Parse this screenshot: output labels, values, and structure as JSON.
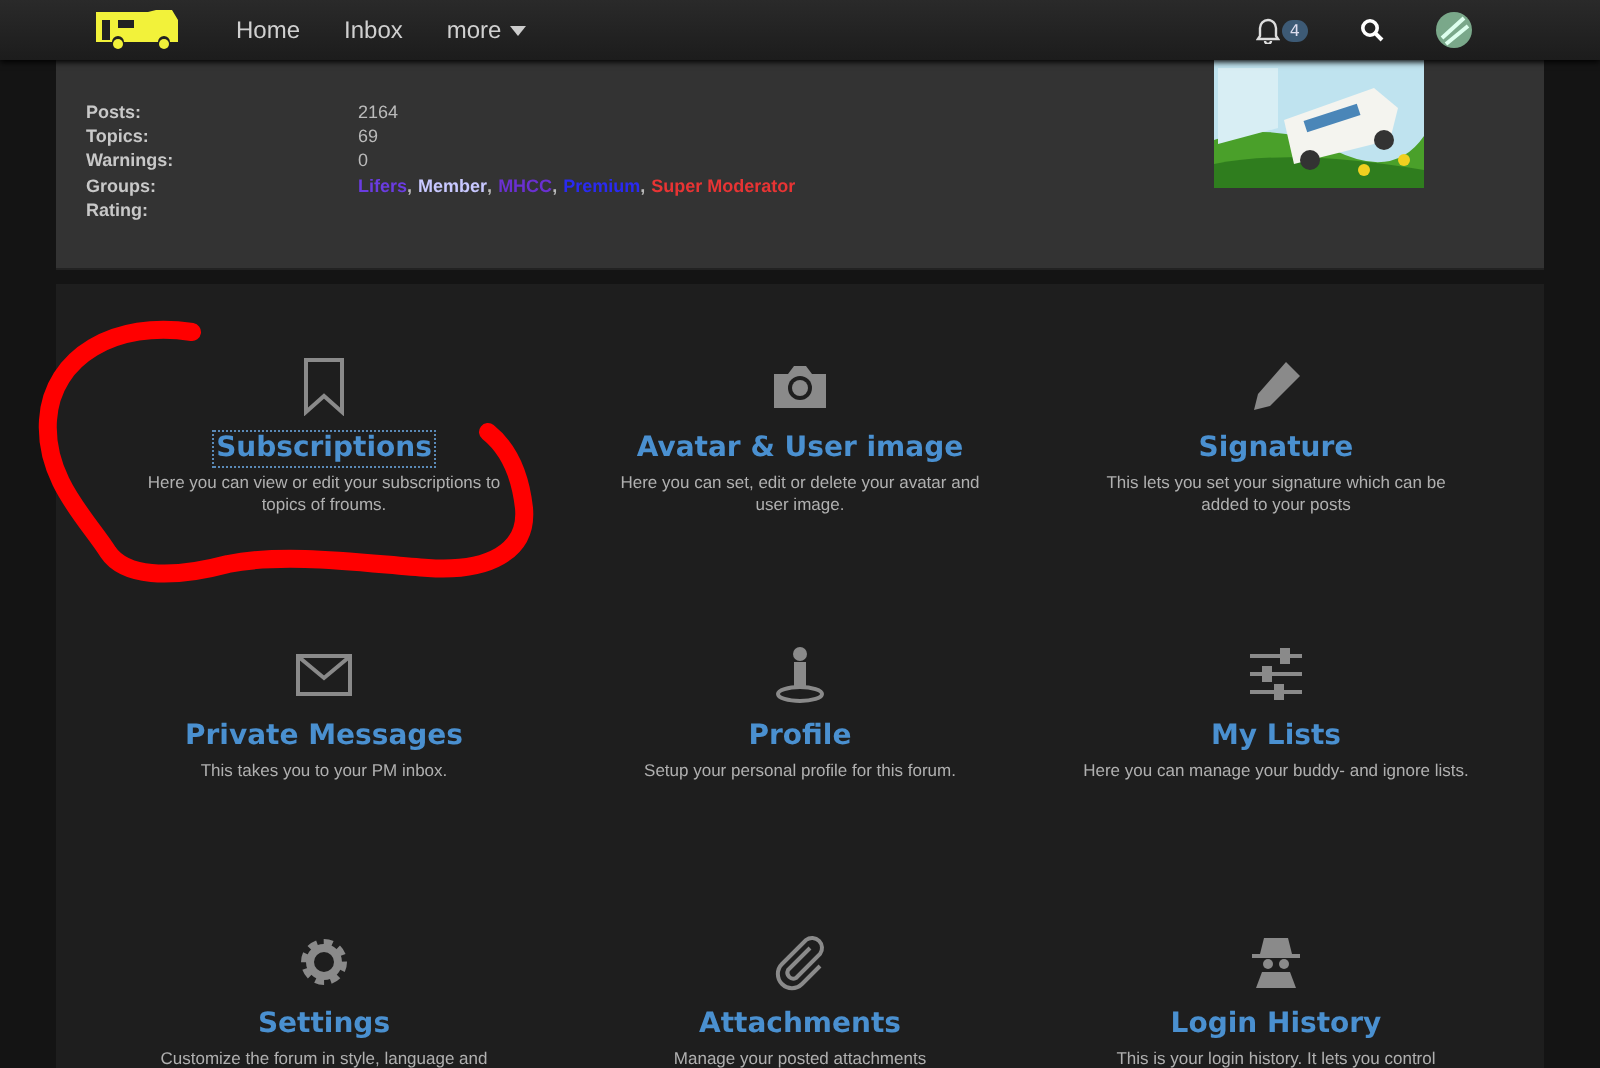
{
  "navbar": {
    "links": [
      {
        "label": "Home"
      },
      {
        "label": "Inbox"
      },
      {
        "label": "more",
        "dropdown": true
      }
    ],
    "notifications": {
      "count": "4"
    }
  },
  "profile": {
    "stats": [
      {
        "label": "Posts:",
        "value": "2164"
      },
      {
        "label": "Topics:",
        "value": "69"
      },
      {
        "label": "Warnings:",
        "value": "0"
      },
      {
        "label": "Groups:",
        "groups": [
          {
            "name": "Lifers",
            "color": "#6a3ce0",
            "separator": ","
          },
          {
            "name": "Member",
            "color": "#c8c8ff",
            "separator": ","
          },
          {
            "name": "MHCC",
            "color": "#6a30d0",
            "separator": ","
          },
          {
            "name": "Premium",
            "color": "#2a2af0",
            "separator": ","
          },
          {
            "name": "Super Moderator",
            "color": "#e83434"
          }
        ]
      },
      {
        "label": "Rating:"
      }
    ]
  },
  "tiles": [
    {
      "kind": "bookmark",
      "title": "Subscriptions",
      "description": "Here you can view or edit your subscriptions to topics of froums.",
      "focused": true,
      "circled": true
    },
    {
      "kind": "camera",
      "title": "Avatar & User image",
      "description": "Here you can set, edit or delete your avatar and user image.",
      "focused": false,
      "circled": false
    },
    {
      "kind": "pencil",
      "title": "Signature",
      "description": "This lets you set your signature which can be added to your posts",
      "focused": false,
      "circled": false
    },
    {
      "kind": "envelope",
      "title": "Private Messages",
      "description": "This takes you to your PM inbox.",
      "focused": false,
      "circled": false
    },
    {
      "kind": "person",
      "title": "Profile",
      "description": "Setup your personal profile for this forum.",
      "focused": false,
      "circled": false
    },
    {
      "kind": "sliders",
      "title": "My Lists",
      "description": "Here you can manage your buddy- and ignore lists.",
      "focused": false,
      "circled": false
    },
    {
      "kind": "gear",
      "title": "Settings",
      "description": "Customize the forum in style, language and",
      "focused": false,
      "circled": false
    },
    {
      "kind": "paperclip",
      "title": "Attachments",
      "description": "Manage your posted attachments",
      "focused": false,
      "circled": false
    },
    {
      "kind": "spy",
      "title": "Login History",
      "description": "This is your login history. It lets you control",
      "focused": false,
      "circled": false
    }
  ]
}
